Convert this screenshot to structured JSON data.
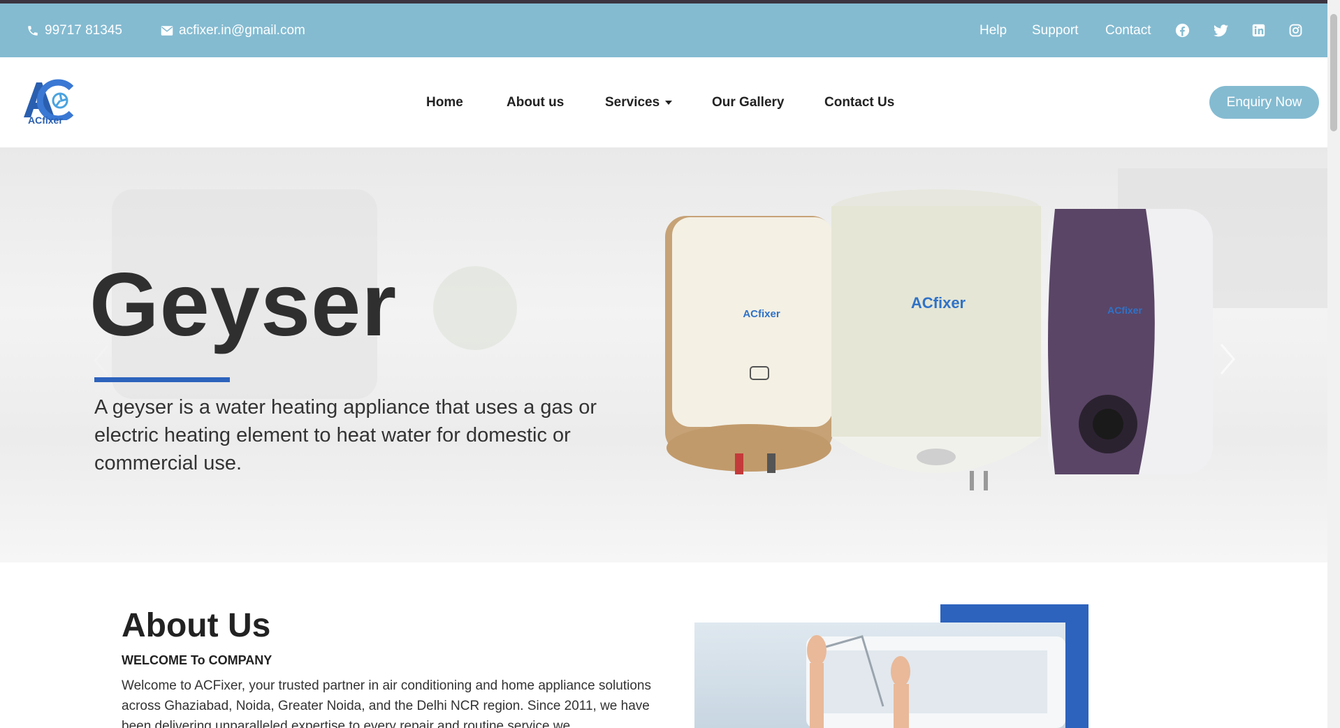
{
  "topbar": {
    "phone": "99717 81345",
    "email": "acfixer.in@gmail.com",
    "links": [
      "Help",
      "Support",
      "Contact"
    ],
    "social": [
      "facebook-icon",
      "twitter-icon",
      "linkedin-icon",
      "instagram-icon"
    ]
  },
  "nav": {
    "logo_text": "ACfixer",
    "items": [
      "Home",
      "About us",
      "Services",
      "Our Gallery",
      "Contact Us"
    ],
    "enquiry": "Enquiry Now"
  },
  "hero": {
    "title": "Geyser",
    "description": "A geyser is a water heating appliance that uses a gas or electric heating element to heat water for domestic or commercial use.",
    "product_brand": "ACfixer"
  },
  "about": {
    "title": "About Us",
    "subtitle": "WELCOME To COMPANY",
    "text": "Welcome to ACFixer, your trusted partner in air conditioning and home appliance solutions across Ghaziabad, Noida, Greater Noida, and the Delhi NCR region. Since 2011, we have been delivering unparalleled expertise to every repair and routine service we"
  },
  "colors": {
    "topbar": "#84bbd1",
    "accent": "#2d63bd",
    "text": "#222222"
  }
}
